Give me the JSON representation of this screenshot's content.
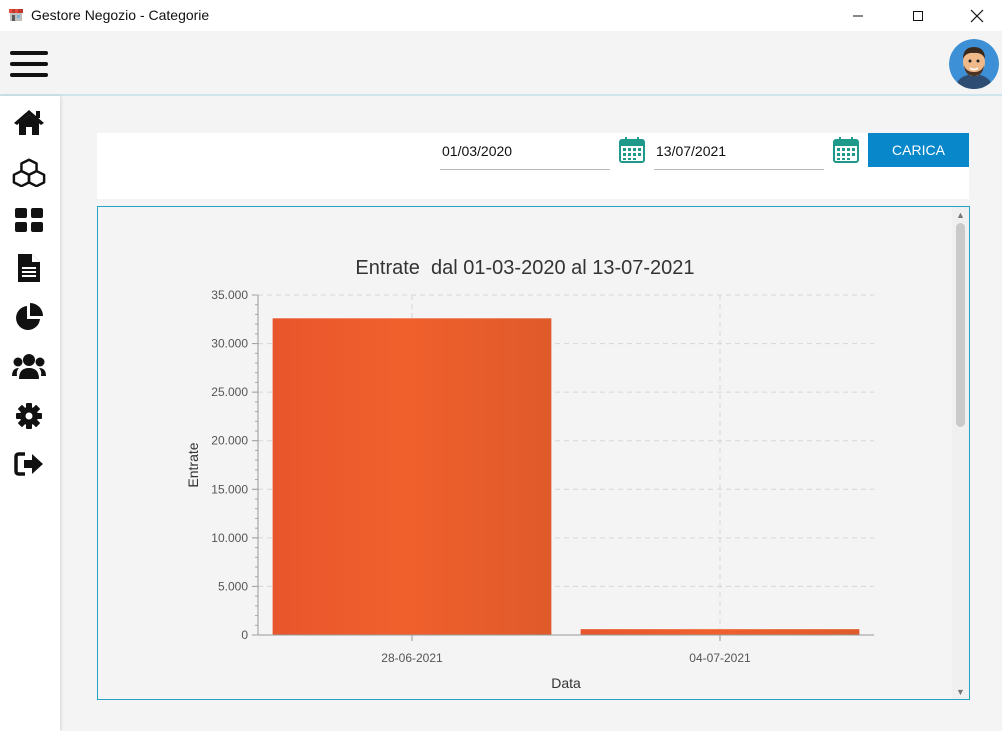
{
  "window": {
    "title": "Gestore Negozio - Categorie"
  },
  "sidebar": {
    "items": [
      {
        "icon": "home-icon"
      },
      {
        "icon": "cubes-icon"
      },
      {
        "icon": "grid-icon"
      },
      {
        "icon": "document-icon"
      },
      {
        "icon": "pie-chart-icon"
      },
      {
        "icon": "users-icon"
      },
      {
        "icon": "gear-icon"
      },
      {
        "icon": "logout-icon"
      }
    ]
  },
  "filters": {
    "date_from": "01/03/2020",
    "date_to": "13/07/2021",
    "load_label": "CARICA"
  },
  "colors": {
    "accent": "#0987cb",
    "bar": "#f0602d",
    "frame": "#22a3c6"
  },
  "chart_data": {
    "type": "bar",
    "title": "Entrate  dal 01-03-2020 al 13-07-2021",
    "xlabel": "Data",
    "ylabel": "Entrate",
    "categories": [
      "28-06-2021",
      "04-07-2021"
    ],
    "values": [
      32600,
      600
    ],
    "ylim": [
      0,
      35000
    ],
    "yticks": [
      0,
      5000,
      10000,
      15000,
      20000,
      25000,
      30000,
      35000
    ],
    "ytick_labels": [
      "0",
      "5.000",
      "10.000",
      "15.000",
      "20.000",
      "25.000",
      "30.000",
      "35.000"
    ],
    "grid": true,
    "legend": "none"
  }
}
